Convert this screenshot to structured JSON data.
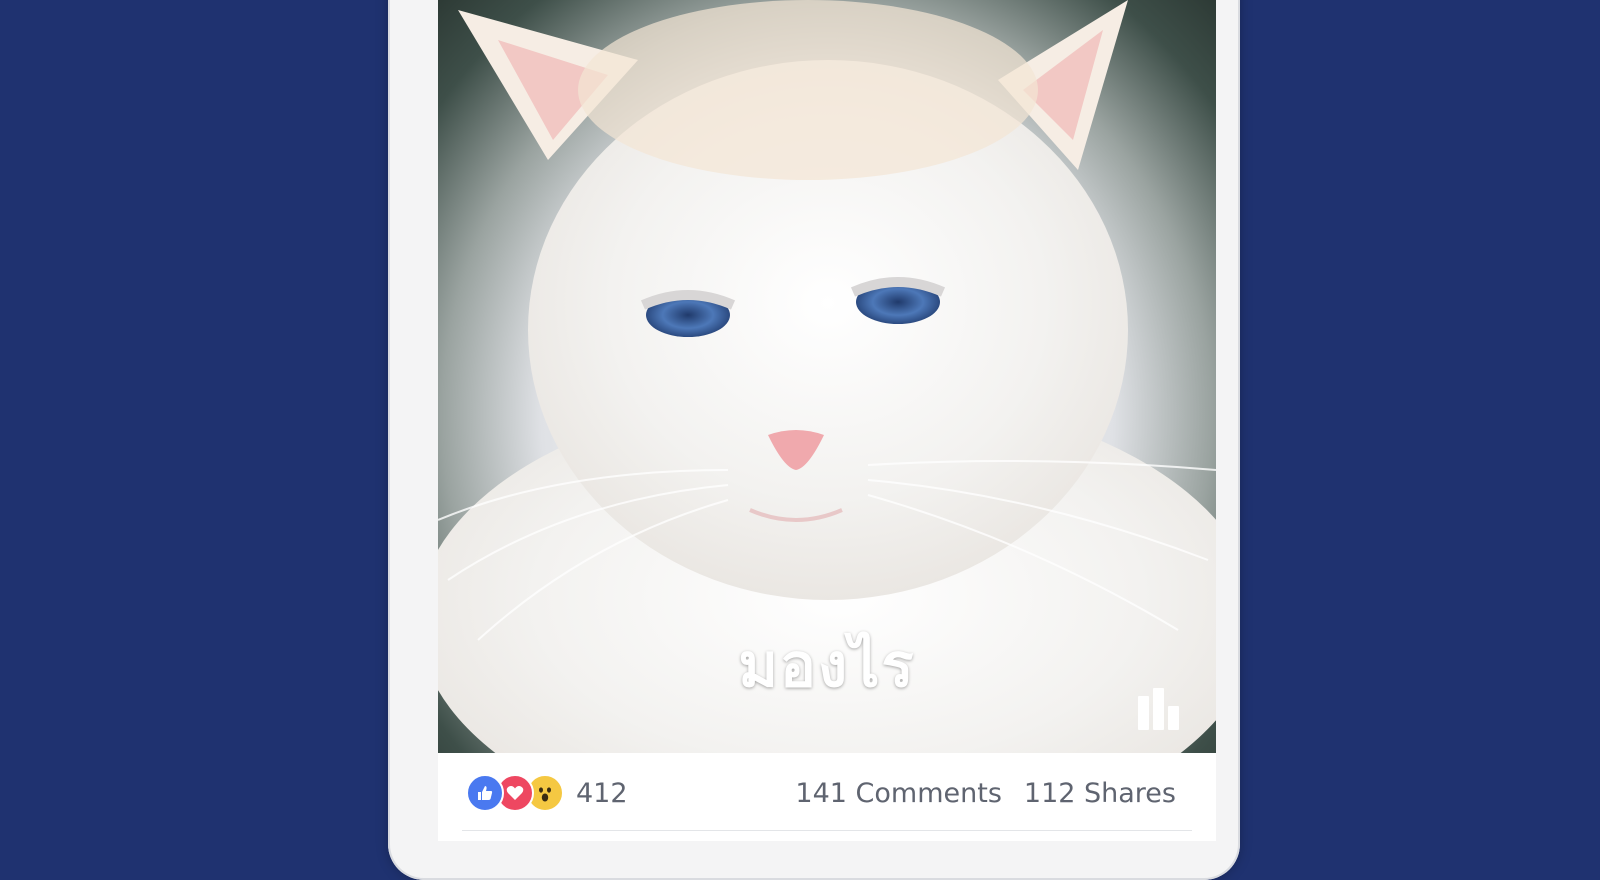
{
  "post": {
    "photo_alt": "white cat with blue eyes",
    "overlay_text": "มองไร",
    "insights_icon": "bar-chart-icon"
  },
  "stats": {
    "reaction_icons": [
      "like-icon",
      "love-icon",
      "wow-icon"
    ],
    "reaction_count": "412",
    "comments": "141 Comments",
    "shares": "112 Shares"
  },
  "colors": {
    "background": "#1f3270",
    "like": "#4a79f0",
    "love": "#ee4761",
    "wow": "#f5c842",
    "stat_text": "#5f6470"
  }
}
